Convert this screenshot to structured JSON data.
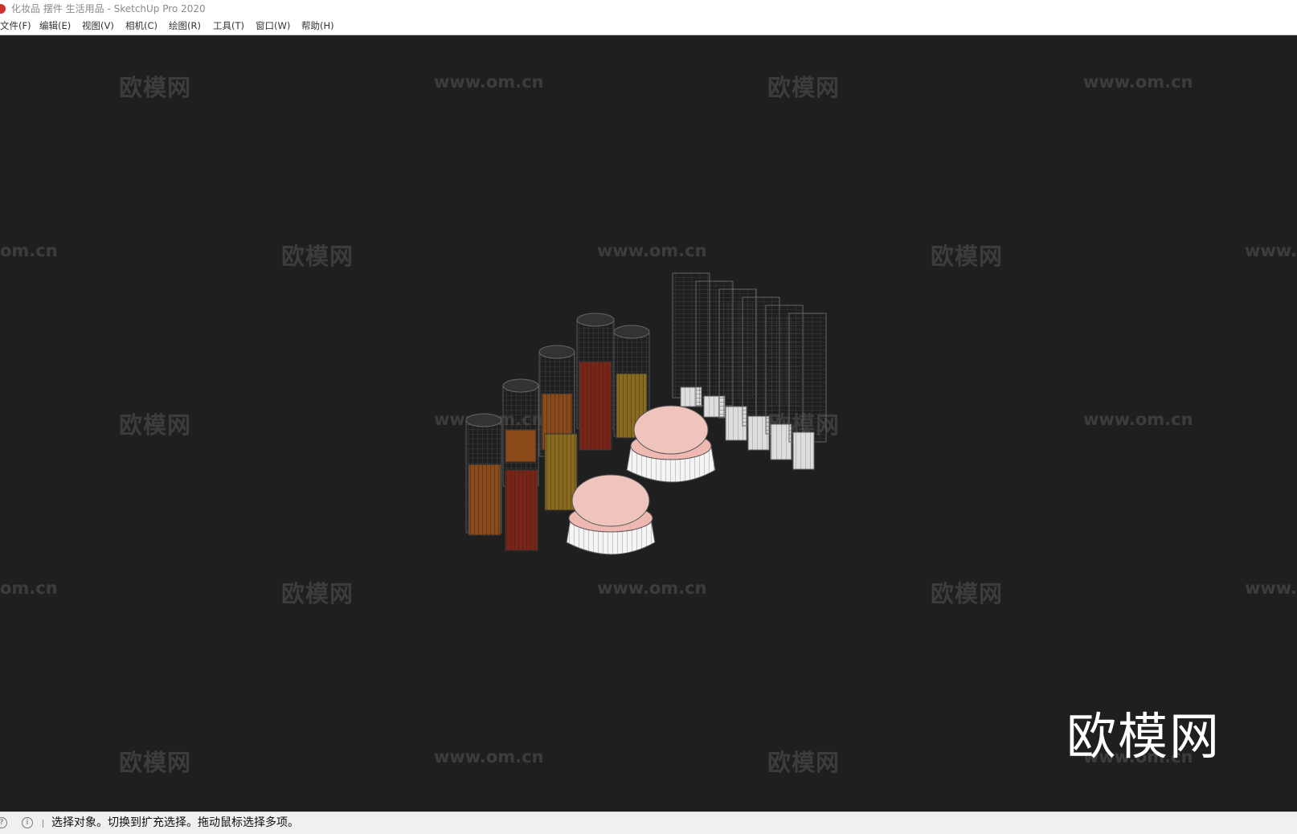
{
  "window": {
    "title": "化妆品 摆件 生活用品 - SketchUp Pro 2020"
  },
  "menu": {
    "items": [
      "文件(F)",
      "编辑(E)",
      "视图(V)",
      "相机(C)",
      "绘图(R)",
      "工具(T)",
      "窗口(W)",
      "帮助(H)"
    ]
  },
  "watermarks": {
    "cn": "欧模网",
    "url": "www.om.cn",
    "url_partial_left": "om.cn",
    "url_partial_right": "www."
  },
  "brand": {
    "logo_text": "欧模网"
  },
  "status": {
    "text": "选择对象。切换到扩充选择。拖动鼠标选择多项。",
    "icons": [
      "help-icon",
      "info-icon"
    ]
  },
  "colors": {
    "viewport_bg": "#1f1f1f",
    "jar_lid_pink": "#efb9b2",
    "jar_base_white": "#f4f4f4",
    "bottle_amber": "#8a4a1a",
    "bottle_red": "#7a2418",
    "bottle_gold": "#8a6a1c"
  }
}
